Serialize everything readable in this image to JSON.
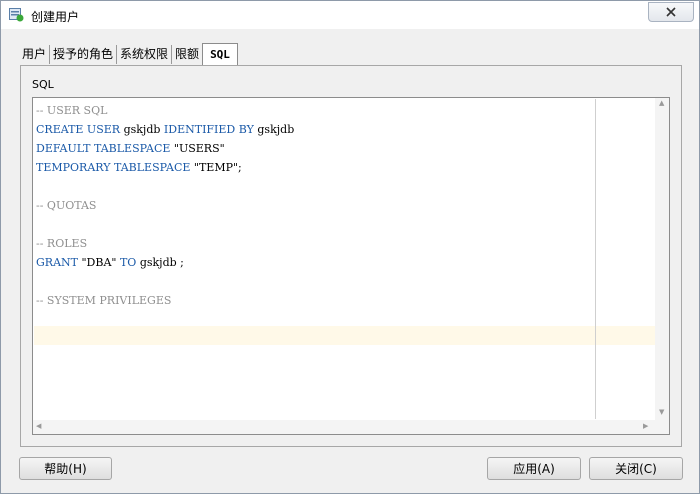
{
  "window": {
    "title": "创建用户",
    "close_icon": "close-icon (×)"
  },
  "tabs": [
    {
      "label": "用户",
      "active": false
    },
    {
      "label": "授予的角色",
      "active": false
    },
    {
      "label": "系统权限",
      "active": false
    },
    {
      "label": "限额",
      "active": false
    },
    {
      "label": "SQL",
      "active": true
    }
  ],
  "sql_panel": {
    "label": "SQL",
    "lines": [
      [
        {
          "t": "-- USER SQL",
          "c": "cm"
        }
      ],
      [
        {
          "t": "CREATE USER ",
          "c": "kw"
        },
        {
          "t": "gskjdb ",
          "c": "tx"
        },
        {
          "t": "IDENTIFIED BY ",
          "c": "kw"
        },
        {
          "t": "gskjdb",
          "c": "tx"
        }
      ],
      [
        {
          "t": "DEFAULT TABLESPACE ",
          "c": "kw"
        },
        {
          "t": "\"USERS\"",
          "c": "tx"
        }
      ],
      [
        {
          "t": "TEMPORARY TABLESPACE ",
          "c": "kw"
        },
        {
          "t": "\"TEMP\";",
          "c": "tx"
        }
      ],
      [],
      [
        {
          "t": "-- QUOTAS",
          "c": "cm"
        }
      ],
      [],
      [
        {
          "t": "-- ROLES",
          "c": "cm"
        }
      ],
      [
        {
          "t": "GRANT ",
          "c": "kw"
        },
        {
          "t": "\"DBA\" ",
          "c": "tx"
        },
        {
          "t": "TO ",
          "c": "kw"
        },
        {
          "t": "gskjdb ;",
          "c": "tx"
        }
      ],
      [],
      [
        {
          "t": "-- SYSTEM PRIVILEGES",
          "c": "cm"
        }
      ]
    ]
  },
  "buttons": {
    "help": "帮助(H)",
    "apply": "应用(A)",
    "close": "关闭(C)"
  },
  "colors": {
    "keyword": "#1b5aa8",
    "comment": "#8f8f8f",
    "current_line": "#fff9e8"
  }
}
